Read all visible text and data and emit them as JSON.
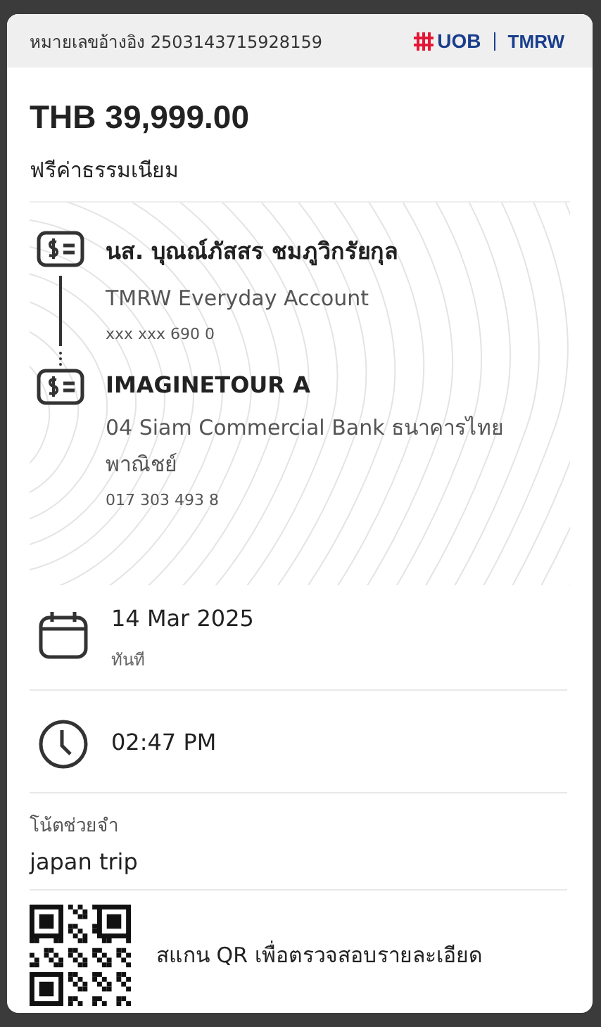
{
  "header": {
    "reference": "หมายเลขอ้างอิง 2503143715928159",
    "logo": {
      "brand": "UOB",
      "product": "TMRW"
    }
  },
  "amount": "THB 39,999.00",
  "fee_note": "ฟรีค่าธรรมเนียม",
  "parties": [
    {
      "name": "นส. บุณณ์ภัสสร ชมภูวิกรัยกุล",
      "account_name": "TMRW Everyday Account",
      "account_number": "xxx xxx 690 0"
    },
    {
      "name": "IMAGINETOUR A",
      "account_name": "04 Siam Commercial Bank ธนาคารไทยพาณิชย์",
      "account_number": "017 303 493 8"
    }
  ],
  "date": {
    "value": "14 Mar 2025",
    "note": "ทันที"
  },
  "time": "02:47 PM",
  "memo": {
    "label": "โน้ตช่วยจำ",
    "value": "japan trip"
  },
  "qr": {
    "caption": "สแกน QR เพื่อตรวจสอบรายละเอียด"
  }
}
